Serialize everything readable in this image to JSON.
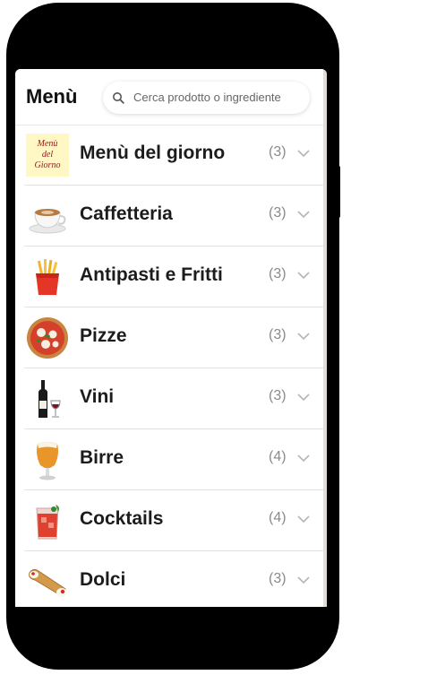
{
  "header": {
    "title": "Menù",
    "search_placeholder": "Cerca prodotto o ingrediente"
  },
  "categories": [
    {
      "name": "Menù del giorno",
      "count": "(3)",
      "icon": "menu-del-giorno-card",
      "icon_lines": [
        "Menù",
        "del",
        "Giorno"
      ]
    },
    {
      "name": "Caffetteria",
      "count": "(3)",
      "icon": "coffee-cup-icon"
    },
    {
      "name": "Antipasti e Fritti",
      "count": "(3)",
      "icon": "fries-icon"
    },
    {
      "name": "Pizze",
      "count": "(3)",
      "icon": "pizza-icon"
    },
    {
      "name": "Vini",
      "count": "(3)",
      "icon": "wine-icon"
    },
    {
      "name": "Birre",
      "count": "(4)",
      "icon": "beer-icon"
    },
    {
      "name": "Cocktails",
      "count": "(4)",
      "icon": "cocktail-icon"
    },
    {
      "name": "Dolci",
      "count": "(3)",
      "icon": "cannolo-icon"
    }
  ],
  "colors": {
    "phone_frame": "#000000",
    "text": "#1c1c1c",
    "count": "#8a8a8a",
    "divider": "#e2e2e2"
  }
}
